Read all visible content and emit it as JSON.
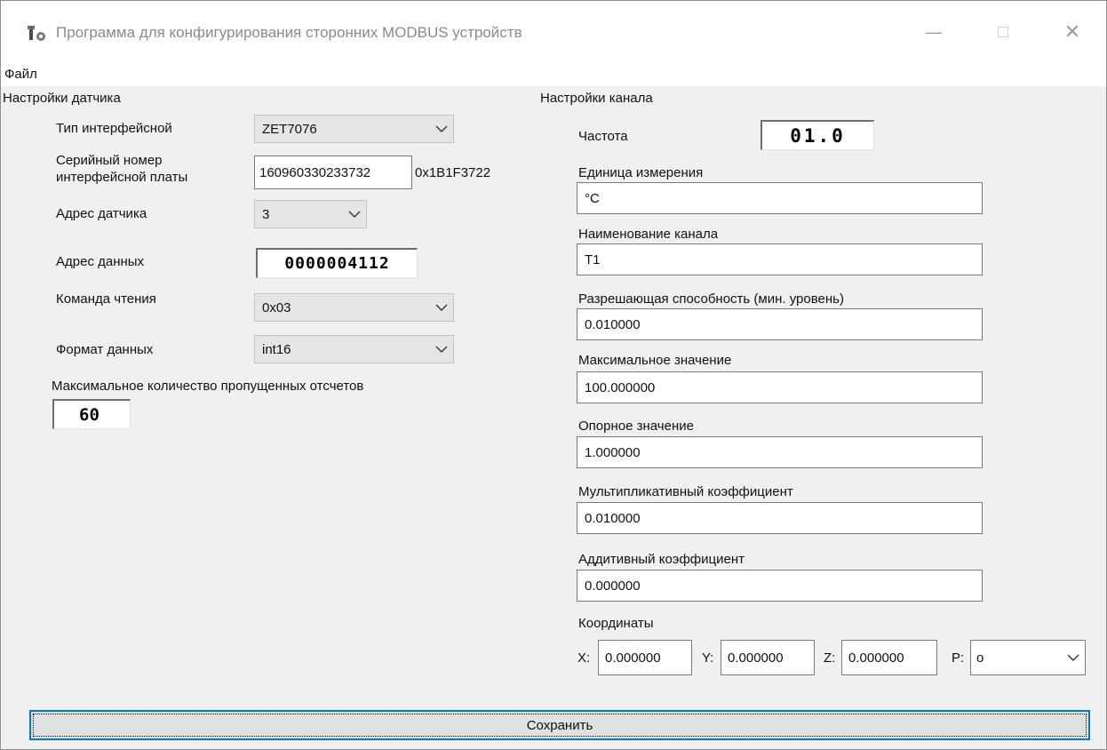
{
  "window": {
    "title": "Программа для конфигурирования сторонних MODBUS устройств",
    "controls": {
      "minimize": "—",
      "close": "✕"
    }
  },
  "menu": {
    "file": "Файл"
  },
  "sensor": {
    "section_title": "Настройки датчика",
    "interface_type_label": "Тип интерфейсной",
    "interface_type_value": "ZET7076",
    "serial_label_line1": "Серийный номер",
    "serial_label_line2": "интерфейсной платы",
    "serial_value": "160960330233732",
    "serial_hex": "0x1B1F3722",
    "address_label": "Адрес датчика",
    "address_value": "3",
    "data_address_label": "Адрес данных",
    "data_address_value": "0000004112",
    "read_command_label": "Команда чтения",
    "read_command_value": "0x03",
    "data_format_label": "Формат данных",
    "data_format_value": "int16",
    "max_missed_label": "Максимальное количество пропущенных отсчетов",
    "max_missed_value": "60"
  },
  "channel": {
    "section_title": "Настройки канала",
    "frequency_label": "Частота",
    "frequency_value": "01.0",
    "unit_label": "Единица измерения",
    "unit_value": "°C",
    "name_label": "Наименование канала",
    "name_value": "T1",
    "resolution_label": "Разрешающая способность (мин. уровень)",
    "resolution_value": "0.010000",
    "max_value_label": "Максимальное значение",
    "max_value_value": "100.000000",
    "reference_label": "Опорное значение",
    "reference_value": "1.000000",
    "mult_coef_label": "Мультипликативный коэффициент",
    "mult_coef_value": "0.010000",
    "add_coef_label": "Аддитивный коэффициент",
    "add_coef_value": "0.000000",
    "coords_label": "Координаты",
    "x_label": "X:",
    "x_value": "0.000000",
    "y_label": "Y:",
    "y_value": "0.000000",
    "z_label": "Z:",
    "z_value": "0.000000",
    "p_label": "P:",
    "p_value": "o"
  },
  "actions": {
    "save": "Сохранить"
  },
  "icons": {
    "app": "app-tools-icon",
    "chevron": "chevron-down-icon"
  },
  "colors": {
    "focus_border": "#0078d7",
    "title_text": "#8a8a8a",
    "window_bg": "#f0f0f0"
  }
}
